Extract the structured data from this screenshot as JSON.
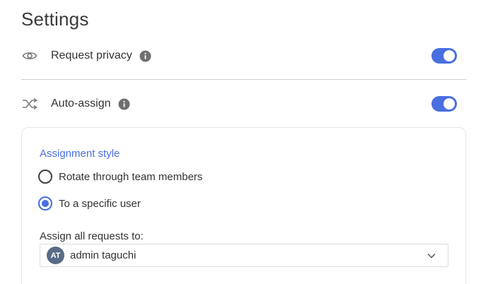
{
  "page": {
    "title": "Settings"
  },
  "settings": {
    "request_privacy": {
      "label": "Request privacy",
      "icon": "eye-icon",
      "enabled": true
    },
    "auto_assign": {
      "label": "Auto-assign",
      "icon": "shuffle-icon",
      "enabled": true
    }
  },
  "assignment": {
    "heading": "Assignment style",
    "options": [
      {
        "label": "Rotate through team members",
        "selected": false
      },
      {
        "label": "To a specific user",
        "selected": true
      }
    ],
    "assign_label": "Assign all requests to:",
    "selected_user": {
      "initials": "AT",
      "name": "admin taguchi"
    }
  },
  "colors": {
    "accent": "#4a6ee0",
    "avatar": "#5a6b87",
    "divider": "#cfcfcf"
  }
}
